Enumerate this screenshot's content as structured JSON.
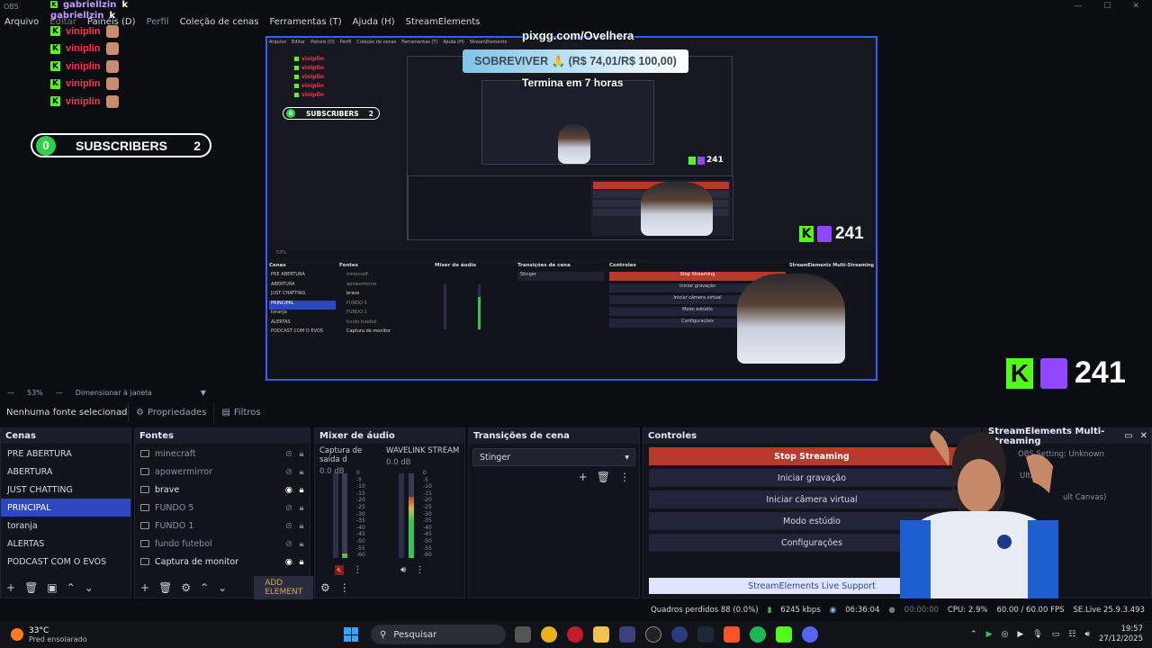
{
  "app": {
    "title": "OBS"
  },
  "window_controls": {
    "minimize": "—",
    "maximize": "☐",
    "close": "✕"
  },
  "menu": [
    "Arquivo",
    "Editar",
    "Painéis (D)",
    "Perfil",
    "Coleção de cenas",
    "Ferramentas (T)",
    "Ajuda (H)",
    "StreamElements"
  ],
  "chat_overlay": {
    "top_names": [
      "gabriellzin",
      "gabriellzin"
    ],
    "rows": [
      "viniplin",
      "viniplin",
      "viniplin",
      "viniplin",
      "viniplin"
    ]
  },
  "subscribers": {
    "left_count": "0",
    "label": "SUBSCRIBERS",
    "count": "2"
  },
  "preview": {
    "pixgg": "pixgg.com/Ovelhera",
    "goal": "SOBREVIVER 🙏 (R$ 74,01/R$ 100,00)",
    "goal_sub": "Termina em 7 horas",
    "follower_count_big": "241",
    "follower_count_mid": "241",
    "nested_subs_label": "SUBSCRIBERS",
    "nested_subs_count": "2",
    "nested_subs_left": "0",
    "nested_controls": [
      "Stop Streaming",
      "Iniciar gravação",
      "Iniciar câmera virtual",
      "Modo estúdio",
      "Configurações"
    ],
    "nested_scenes": [
      "PRE ABERTURA",
      "ABERTURA",
      "JUST CHATTING",
      "PRINCIPAL",
      "toranja",
      "ALERTAS",
      "PODCAST COM O EVOS"
    ],
    "nested_sources": [
      "minecraft",
      "apowermirror",
      "brave",
      "FUNDO 5",
      "FUNDO 1",
      "fundo futebol",
      "Captura de monitor"
    ]
  },
  "zoom": {
    "level": "53%",
    "mode": "Dimensionar à janela"
  },
  "source_bar": {
    "none_selected": "Nenhuma fonte selecionad",
    "properties": "Propriedades",
    "filters": "Filtros"
  },
  "scenes": {
    "title": "Cenas",
    "items": [
      "PRE ABERTURA",
      "ABERTURA",
      "JUST CHATTING",
      "PRINCIPAL",
      "toranja",
      "ALERTAS",
      "PODCAST COM O EVOS"
    ],
    "active_index": 3
  },
  "sources": {
    "title": "Fontes",
    "items": [
      {
        "name": "minecraft",
        "visible": false
      },
      {
        "name": "apowermirror",
        "visible": false
      },
      {
        "name": "brave",
        "visible": true
      },
      {
        "name": "FUNDO 5",
        "visible": false
      },
      {
        "name": "FUNDO 1",
        "visible": false
      },
      {
        "name": "fundo futebol",
        "visible": false
      },
      {
        "name": "Captura de monitor",
        "visible": true
      }
    ],
    "add_element": "ADD ELEMENT"
  },
  "mixer": {
    "title": "Mixer de áudio",
    "channels": [
      {
        "name": "Captura de saída d",
        "db": "0.0 dB",
        "level": 0.05
      },
      {
        "name": "WAVELINK STREAM",
        "db": "0.0 dB",
        "level": 0.72
      }
    ],
    "scale": [
      "0",
      "-5",
      "-10",
      "-15",
      "-20",
      "-25",
      "-30",
      "-35",
      "-40",
      "-45",
      "-50",
      "-55",
      "-60"
    ]
  },
  "transitions": {
    "title": "Transições de cena",
    "selected": "Stinger"
  },
  "controls": {
    "title": "Controles",
    "stop": "Stop Streaming",
    "record": "Iniciar gravação",
    "virtual_cam": "Iniciar câmera virtual",
    "studio": "Modo estúdio",
    "settings": "Configurações",
    "support": "StreamElements Live Support"
  },
  "multistream": {
    "title": "StreamElements Multi-Streaming",
    "obs_setting": "OBS Setting: Unknown",
    "row2": "UltraM",
    "row3": "ult Canvas)"
  },
  "status": {
    "dropped": "Quadros perdidos 88 (0.0%)",
    "bitrate": "6245 kbps",
    "live_time": "06:36:04",
    "rec_time": "00:00:00",
    "cpu": "CPU: 2.9%",
    "fps": "60.00 / 60.00 FPS",
    "version": "SE.Live 25.9.3.493"
  },
  "taskbar": {
    "temp": "33°C",
    "weather": "Pred ensolarado",
    "search": "Pesquisar",
    "time": "19:57",
    "date": "27/12/2025"
  },
  "colors": {
    "accent": "#2d47c0",
    "kick": "#53fc18",
    "twitch": "#9146ff",
    "stop": "#b53a2c",
    "preview_border": "#2a62ff"
  }
}
